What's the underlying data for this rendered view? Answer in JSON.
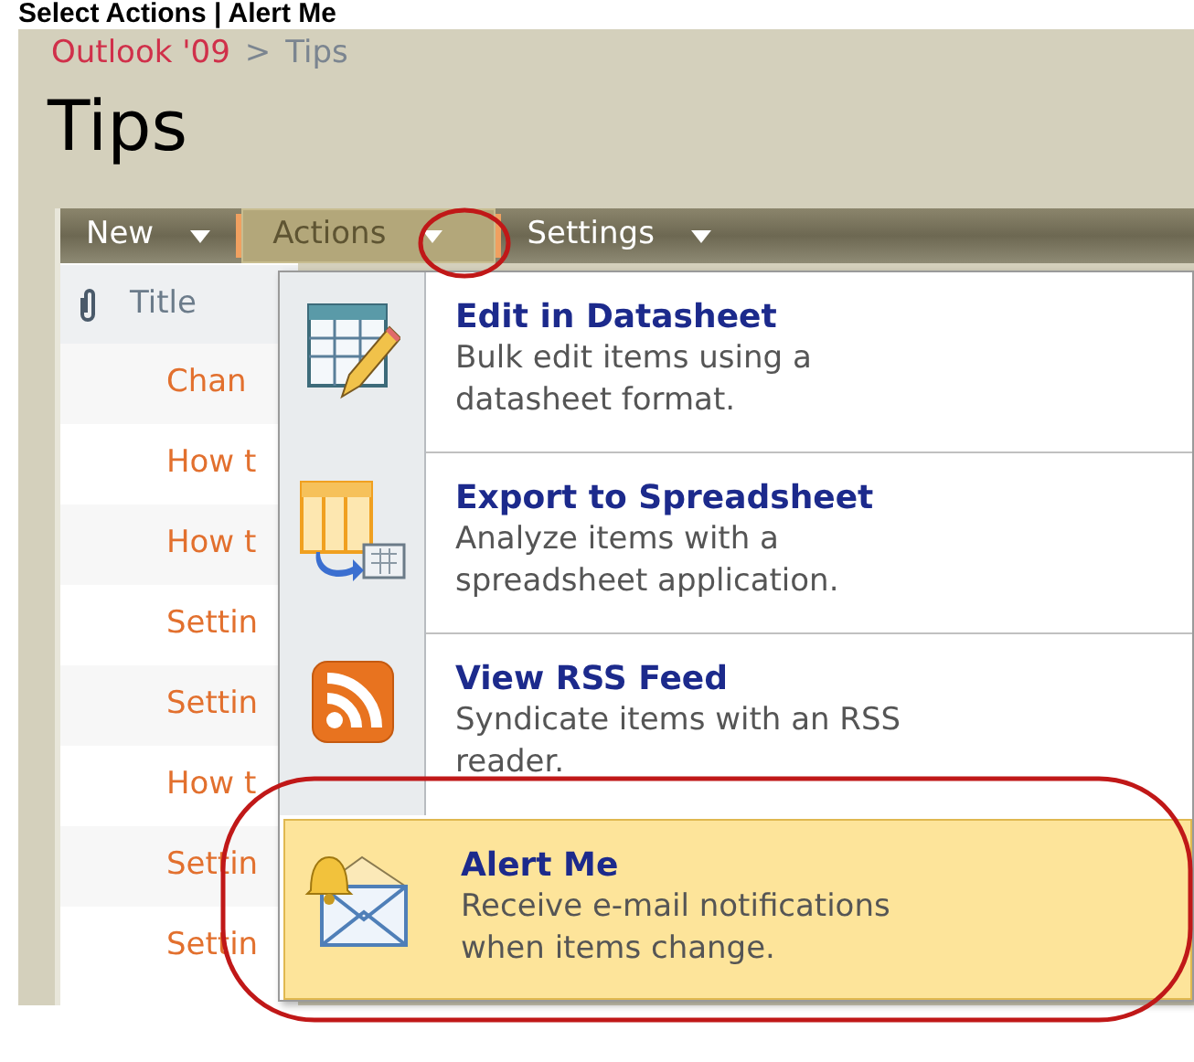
{
  "caption": "Select Actions | Alert Me",
  "breadcrumb": {
    "site": "Outlook '09",
    "separator": ">",
    "page": "Tips"
  },
  "title": "Tips",
  "toolbar": [
    {
      "label": "New",
      "selected": false
    },
    {
      "label": "Actions",
      "selected": true
    },
    {
      "label": "Settings",
      "selected": false
    }
  ],
  "list": {
    "column": "Title",
    "rows": [
      "Chan",
      "How t",
      "How t",
      "Settin",
      "Settin",
      "How t",
      "Settin",
      "Settin"
    ]
  },
  "menu": {
    "items": [
      {
        "kind": "datasheet",
        "title": "Edit in Datasheet",
        "lines": [
          "Bulk edit items using a",
          "datasheet format."
        ],
        "selected": false
      },
      {
        "kind": "spreadsheet",
        "title": "Export to Spreadsheet",
        "lines": [
          "Analyze items with a",
          "spreadsheet application."
        ],
        "selected": false
      },
      {
        "kind": "rss",
        "title": "View RSS Feed",
        "lines": [
          "Syndicate items with an RSS",
          "reader."
        ],
        "selected": false
      },
      {
        "kind": "alert",
        "title": "Alert Me",
        "lines": [
          "Receive e-mail notifications",
          "when items change."
        ],
        "selected": true
      }
    ]
  }
}
